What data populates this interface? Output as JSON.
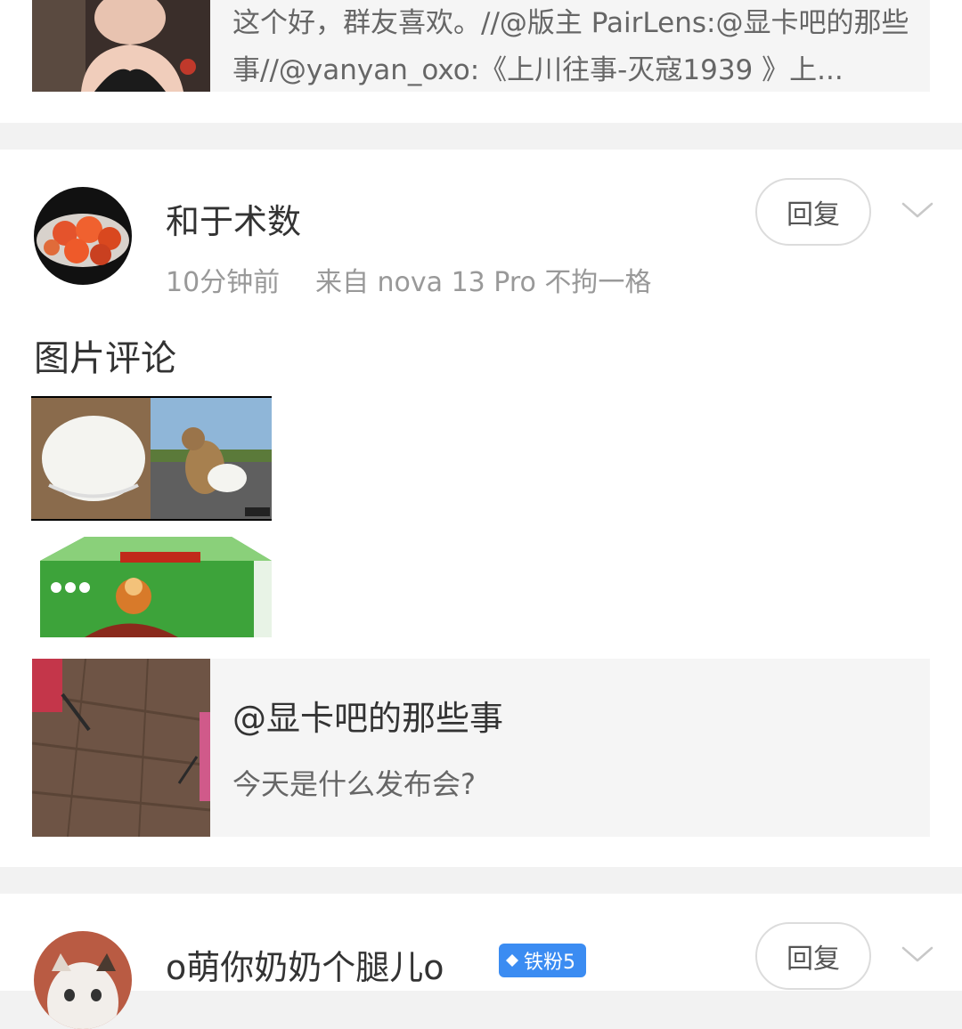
{
  "prev_post": {
    "quote_text": "这个好，群友喜欢。//@版主 PairLens:@显卡吧的那些事//@yanyan_oxo:《上川往事-灭寇1939 》上..."
  },
  "post": {
    "username": "和于术数",
    "time": "10分钟前",
    "source": "来自 nova 13 Pro 不拘一格",
    "reply_label": "回复",
    "content": "图片评论",
    "quote_user": "@显卡吧的那些事",
    "quote_text": "今天是什么发布会?"
  },
  "next_post": {
    "username": "o萌你奶奶个腿儿o",
    "badge": "铁粉5",
    "reply_label": "回复"
  },
  "colors": {
    "badge": "#3b8cf2",
    "separator": "#f2f2f2",
    "quote_bg": "#f5f5f5"
  }
}
